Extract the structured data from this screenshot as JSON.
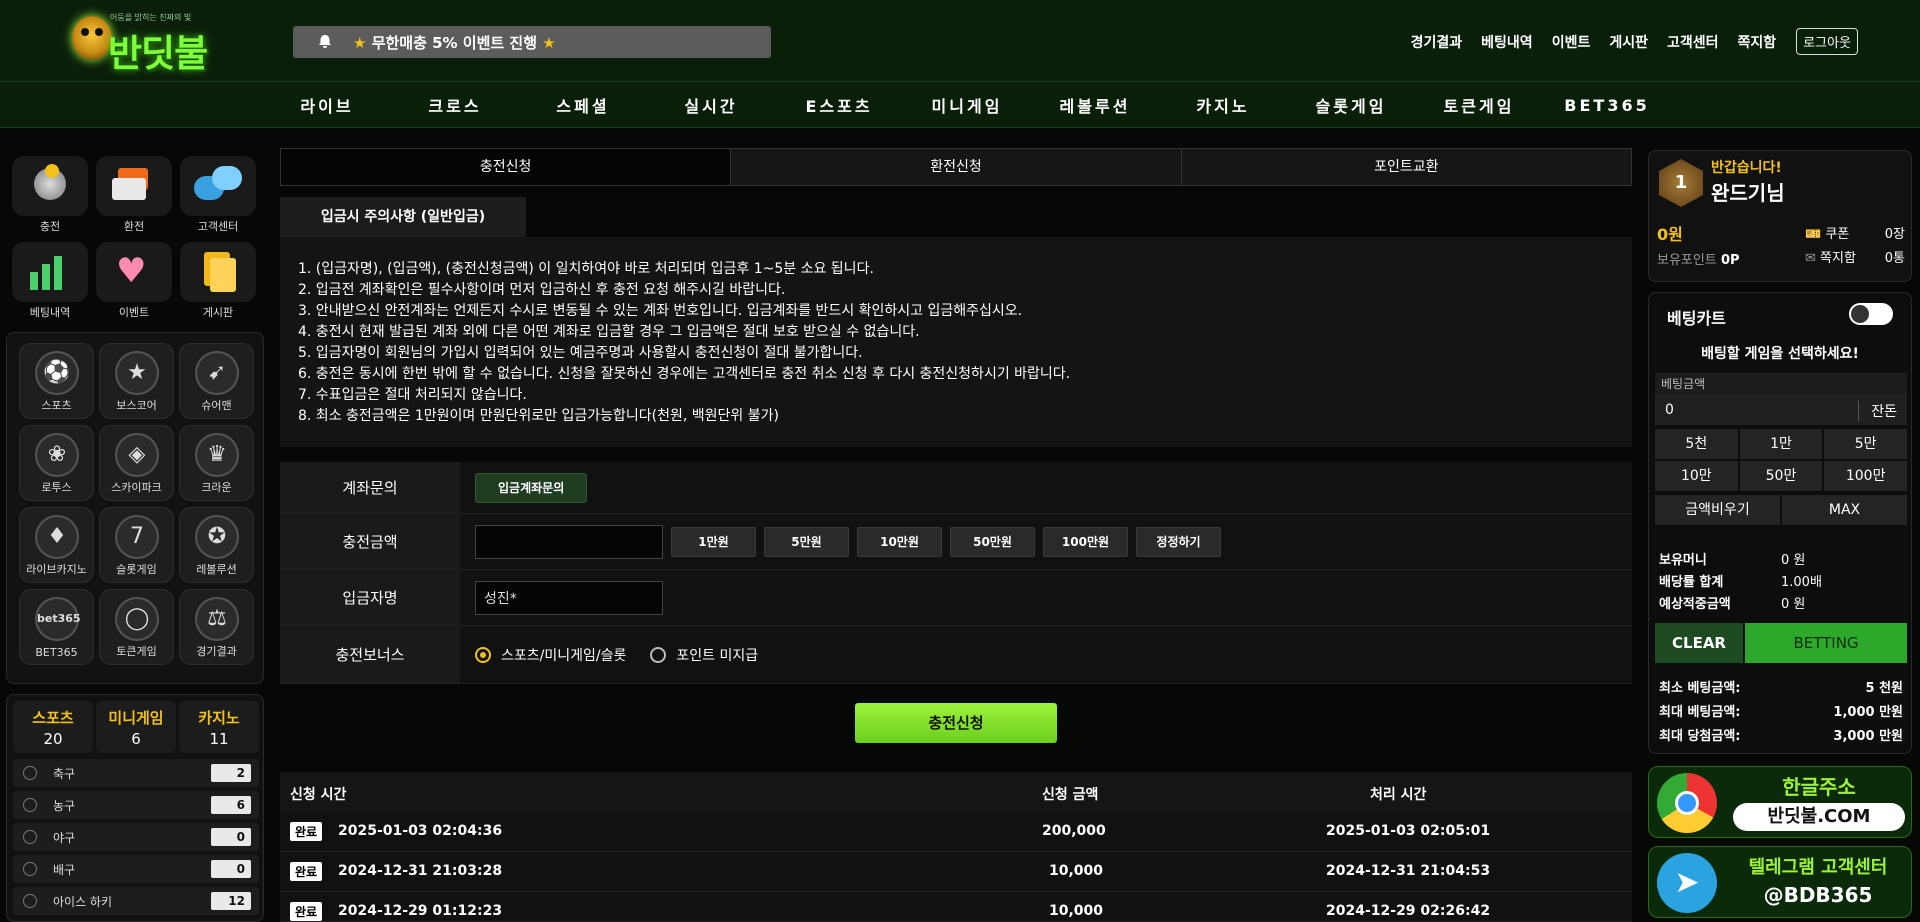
{
  "header": {
    "logo_text": "반딧불",
    "logo_tagline": "어둠을 밝히는 진짜의 빛",
    "notice": "무한매충 5% 이벤트 진행",
    "nav": [
      "경기결과",
      "베팅내역",
      "이벤트",
      "게시판",
      "고객센터",
      "쪽지함"
    ],
    "logout": "로그아웃"
  },
  "main_nav": [
    "라이브",
    "크로스",
    "스페셜",
    "실시간",
    "E스포츠",
    "미니게임",
    "레볼루션",
    "카지노",
    "슬롯게임",
    "토큰게임",
    "BET365"
  ],
  "quick_menu": [
    {
      "label": "충전",
      "icon": "piggy-bank-icon"
    },
    {
      "label": "환전",
      "icon": "cards-icon"
    },
    {
      "label": "고객센터",
      "icon": "chat-icon"
    },
    {
      "label": "베팅내역",
      "icon": "chart-icon"
    },
    {
      "label": "이벤트",
      "icon": "heart-icon"
    },
    {
      "label": "게시판",
      "icon": "board-icon"
    }
  ],
  "sports_menu": [
    {
      "label": "스포츠",
      "icon": "⚽"
    },
    {
      "label": "보스코어",
      "icon": "★"
    },
    {
      "label": "슈어맨",
      "icon": "➹"
    },
    {
      "label": "로투스",
      "icon": "❀"
    },
    {
      "label": "스카이파크",
      "icon": "◈"
    },
    {
      "label": "크라운",
      "icon": "♛"
    },
    {
      "label": "라이브카지노",
      "icon": "♦"
    },
    {
      "label": "슬롯게임",
      "icon": "7"
    },
    {
      "label": "레볼루션",
      "icon": "✪"
    },
    {
      "label": "BET365",
      "icon": "bet365"
    },
    {
      "label": "토큰게임",
      "icon": "◯"
    },
    {
      "label": "경기결과",
      "icon": "⚖"
    }
  ],
  "counts": {
    "tabs": [
      {
        "name": "스포츠",
        "count": "20"
      },
      {
        "name": "미니게임",
        "count": "6"
      },
      {
        "name": "카지노",
        "count": "11"
      }
    ],
    "rows": [
      {
        "name": "축구",
        "count": "2"
      },
      {
        "name": "농구",
        "count": "6"
      },
      {
        "name": "야구",
        "count": "0"
      },
      {
        "name": "배구",
        "count": "0"
      },
      {
        "name": "아이스 하키",
        "count": "12"
      }
    ]
  },
  "tabs": [
    "충전신청",
    "환전신청",
    "포인트교환"
  ],
  "subtab": "입금시 주의사항 (일반입금)",
  "notices": [
    "1. (입금자명), (입금액), (충전신청금액) 이 일치하여야 바로 처리되며 입금후 1~5분 소요 됩니다.",
    "2. 입금전 계좌확인은 필수사항이며 먼저 입금하신 후 충전 요청 해주시길 바랍니다.",
    "3. 안내받으신 안전계좌는 언제든지 수시로 변동될 수 있는 계좌 번호입니다. 입금계좌를 반드시 확인하시고 입금해주십시오.",
    "4. 충전시 현재 발급된 계좌 외에 다른 어떤 계좌로 입금할 경우 그 입금액은 절대 보호 받으실 수 없습니다.",
    "5. 입금자명이 회원님의 가입시 입력되어 있는 예금주명과 사용할시 충전신청이 절대 불가합니다.",
    "6. 충전은 동시에 한번 밖에 할 수 없습니다. 신청을 잘못하신 경우에는 고객센터로 충전 취소 신청 후 다시 충전신청하시기 바랍니다.",
    "7. 수표입금은 절대 처리되지 않습니다.",
    "8. 최소 충전금액은 1만원이며 만원단위로만 입금가능합니다(천원, 백원단위 불가)"
  ],
  "form": {
    "account_label": "계좌문의",
    "account_button": "입금계좌문의",
    "amount_label": "충전금액",
    "amount_value": "",
    "amount_buttons": [
      "1만원",
      "5만원",
      "10만원",
      "50만원",
      "100만원",
      "정정하기"
    ],
    "depositor_label": "입금자명",
    "depositor_value": "성진*",
    "bonus_label": "충전보너스",
    "bonus_options": [
      "스포츠/미니게임/슬롯",
      "포인트 미지급"
    ],
    "submit": "충전신청"
  },
  "history": {
    "headers": [
      "신청 시간",
      "신청 금액",
      "처리 시간"
    ],
    "rows": [
      {
        "status": "완료",
        "requested": "2025-01-03 02:04:36",
        "amount": "200,000",
        "processed": "2025-01-03 02:05:01"
      },
      {
        "status": "완료",
        "requested": "2024-12-31 21:03:28",
        "amount": "10,000",
        "processed": "2024-12-31 21:04:53"
      },
      {
        "status": "완료",
        "requested": "2024-12-29 01:12:23",
        "amount": "10,000",
        "processed": "2024-12-29 02:26:42"
      }
    ]
  },
  "user": {
    "level": "1",
    "greeting": "반갑습니다!",
    "name": "완드기님",
    "money": "0원",
    "points_label": "보유포인트",
    "points": "0P",
    "coupon_label": "쿠폰",
    "coupon": "0장",
    "message_label": "쪽지함",
    "message": "0통"
  },
  "betslip": {
    "title": "베팅카트",
    "select_msg": "배팅할 게임을 선택하세요!",
    "amount_label": "베팅금액",
    "amount_value": "0",
    "change_label": "잔돈",
    "quick": [
      "5천",
      "1만",
      "5만",
      "10만",
      "50만",
      "100만"
    ],
    "clear_amount": "금액비우기",
    "max": "MAX",
    "info": [
      {
        "k": "보유머니",
        "v": "0 원"
      },
      {
        "k": "배당률 합계",
        "v": "1.00배"
      },
      {
        "k": "예상적중금액",
        "v": "0 원"
      }
    ],
    "clear": "CLEAR",
    "betting": "BETTING",
    "limits": [
      {
        "k": "최소 베팅금액:",
        "v": "5 천원"
      },
      {
        "k": "최대 베팅금액:",
        "v": "1,000 만원"
      },
      {
        "k": "최대 당첨금액:",
        "v": "3,000 만원"
      }
    ]
  },
  "banners": [
    {
      "title": "한글주소",
      "sub": "반딧불.COM"
    },
    {
      "title": "텔레그램 고객센터",
      "sub": "@BDB365"
    }
  ],
  "colors": {
    "accent": "#f2c21b",
    "green": "#7dff3a",
    "bg": "#050805"
  }
}
